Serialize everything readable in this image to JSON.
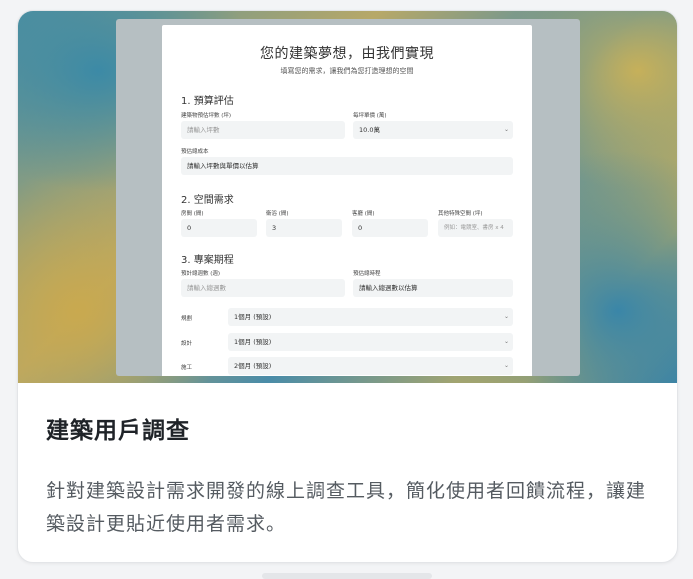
{
  "card": {
    "title": "建築用戶調查",
    "description": "針對建築設計需求開發的線上調查工具，簡化使用者回饋流程，讓建築設計更貼近使用者需求。"
  },
  "form": {
    "title": "您的建築夢想，由我們實現",
    "subtitle": "填寫您的需求，讓我們為您打造理想的空間",
    "section1": {
      "heading": "1. 預算評估",
      "area_label": "建築物預估坪數 (坪)",
      "area_placeholder": "請輸入坪數",
      "unit_label": "每坪單價 (萬)",
      "unit_value": "10.0萬",
      "budget_label": "預估總成本",
      "budget_value": "請輸入坪數與單價以估算"
    },
    "section2": {
      "heading": "2. 空間需求",
      "room1_label": "房間 (間)",
      "room1_value": "0",
      "room2_label": "衛浴 (間)",
      "room2_value": "3",
      "room3_label": "客廳 (間)",
      "room3_value": "0",
      "other_label": "其他特殊空間 (坪)",
      "other_placeholder": "例如：電競室、書房 x 4"
    },
    "section3": {
      "heading": "3. 專案期程",
      "months_label": "預計總週數 (週)",
      "months_placeholder": "請輸入總週數",
      "estimate_label": "預估總時程",
      "estimate_value": "請輸入總週數以估算",
      "rows": [
        {
          "label": "規劃",
          "value": "1個月 (預設)"
        },
        {
          "label": "設計",
          "value": "1個月 (預設)"
        },
        {
          "label": "施工",
          "value": "2個月 (預設)"
        }
      ]
    }
  },
  "icons": {
    "chevron": "chevron-down-icon"
  }
}
